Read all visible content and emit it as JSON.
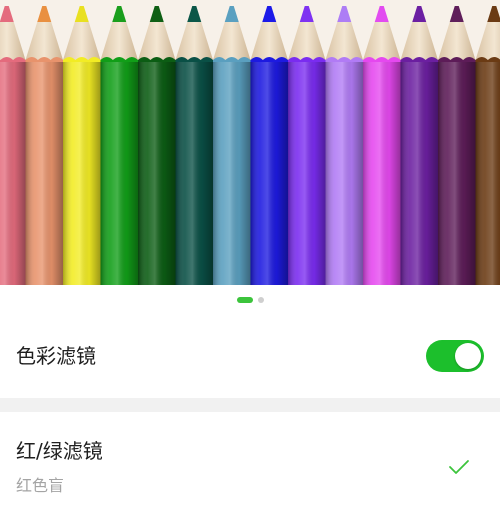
{
  "hero": {
    "pencil_colors": [
      "#e46b7d",
      "#e8936c",
      "#f2ec24",
      "#119e18",
      "#0c5d14",
      "#0a5046",
      "#5a9fbf",
      "#1d1ae0",
      "#7a2cf0",
      "#b17bf5",
      "#e548ef",
      "#6b1fa0",
      "#5d1c58",
      "#6b3b14"
    ],
    "tip_colors": [
      "#e46b7d",
      "#e99040",
      "#e9e020",
      "#1a9e1c",
      "#0f5f14",
      "#0b5748",
      "#5aa0c0",
      "#1c1ae8",
      "#7e32f2",
      "#ad7df5",
      "#e24cf0",
      "#6c1fa2",
      "#5f1e5a",
      "#6b3b14"
    ]
  },
  "pager": {
    "active_index": 0,
    "count": 2,
    "active_color": "#3cc43c",
    "inactive_color": "#cfcfcf"
  },
  "filter_row": {
    "label": "色彩滤镜",
    "toggle_on": true,
    "toggle_color": "#1cbf2c"
  },
  "option_row": {
    "label": "红/绿滤镜",
    "sublabel": "红色盲",
    "selected": true,
    "check_color": "#3cc43c"
  }
}
